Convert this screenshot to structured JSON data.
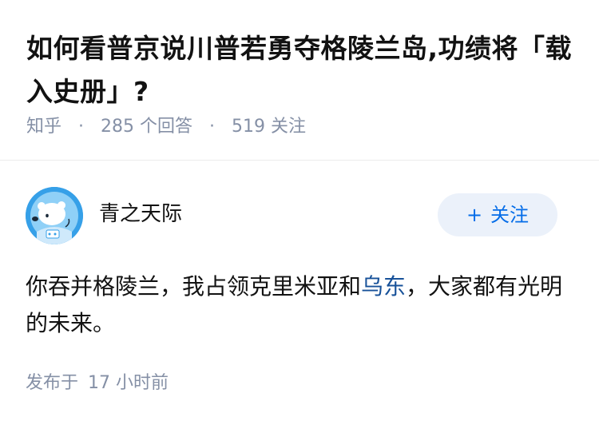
{
  "question": {
    "title": "如何看普京说川普若勇夺格陵兰岛,功绩将「载入史册」?",
    "source": "知乎",
    "answer_count": "285",
    "answer_count_label": "个回答",
    "follower_count": "519",
    "follower_count_label": "关注"
  },
  "answer": {
    "author": {
      "name": "青之天际",
      "avatar_icon": "polar-bear-avatar-icon"
    },
    "follow_button": {
      "icon": "plus-icon",
      "label": "关注"
    },
    "content": {
      "text_before_link": "你吞并格陵兰，我占领克里米亚和",
      "link_text": "乌东",
      "text_after_link": "，大家都有光明的未来。"
    },
    "published_label": "发布于",
    "published_time": "17 小时前"
  },
  "colors": {
    "meta_gray": "#8590a6",
    "link_blue": "#175199",
    "follow_blue": "#056de8",
    "follow_bg": "#ebf1fa",
    "avatar_bg": "#36a0e8"
  }
}
